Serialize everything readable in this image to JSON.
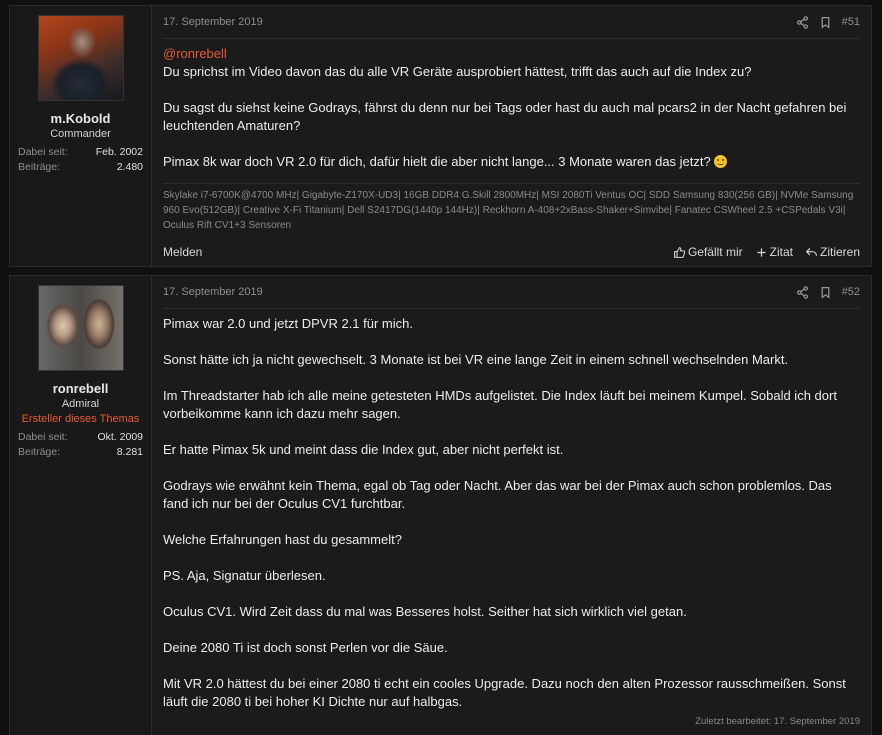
{
  "posts": [
    {
      "user": {
        "name": "m.Kobold",
        "title": "Commander",
        "joined_label": "Dabei seit:",
        "joined": "Feb. 2002",
        "posts_label": "Beiträge:",
        "posts": "2.480"
      },
      "date": "17. September 2019",
      "number": "#51",
      "mention": "@ronrebell",
      "lines": [
        "Du sprichst im Video davon das du alle VR Geräte ausprobiert hättest, trifft das auch auf die Index zu?",
        "Du sagst du siehst keine Godrays, fährst du denn nur bei Tags oder hast du auch mal pcars2 in der Nacht gefahren bei leuchtenden Amaturen?",
        "Pimax 8k war doch VR 2.0 für dich, dafür hielt die aber nicht lange... 3 Monate waren das jetzt?"
      ],
      "signature": "Skylake i7-6700K@4700 MHz| Gigabyte-Z170X-UD3| 16GB DDR4 G.Skill 2800MHz| MSI 2080Ti Ventus OC| SDD Samsung 830(256 GB)| NVMe Samsung 960 Evo(512GB)| Creative X-Fi Titanium| Dell S2417DG(1440p 144Hz)| Reckhorn A-408+2xBass-Shaker+Simvibe| Fanatec CSWheel 2.5 +CSPedals V3i| Oculus Rift CV1+3 Sensoren",
      "report": "Melden",
      "like": "Gefällt mir",
      "quote": "Zitat",
      "reply": "Zitieren"
    },
    {
      "user": {
        "name": "ronrebell",
        "title": "Admiral",
        "banner": "Ersteller dieses Themas",
        "joined_label": "Dabei seit:",
        "joined": "Okt. 2009",
        "posts_label": "Beiträge:",
        "posts": "8.281"
      },
      "date": "17. September 2019",
      "number": "#52",
      "lines": [
        "Pimax war 2.0 und jetzt DPVR 2.1 für mich.",
        "Sonst hätte ich ja nicht gewechselt. 3 Monate ist bei VR eine lange Zeit in einem schnell wechselnden Markt.",
        "Im Threadstarter hab ich alle meine getesteten HMDs aufgelistet. Die Index läuft bei meinem Kumpel. Sobald ich dort vorbeikomme kann ich dazu mehr sagen.",
        "Er hatte Pimax 5k und meint dass die Index gut, aber nicht perfekt ist.",
        "Godrays wie erwähnt kein Thema, egal ob Tag oder Nacht. Aber das war bei der Pimax auch schon problemlos. Das fand ich nur bei der Oculus CV1 furchtbar.",
        "Welche Erfahrungen hast du gesammelt?",
        "PS. Aja, Signatur überlesen.",
        "Oculus CV1. Wird Zeit dass du mal was Besseres holst. Seither hat sich wirklich viel getan.",
        "Deine 2080 Ti ist doch sonst Perlen vor die Säue.",
        "Mit VR 2.0 hättest du bei einer 2080 ti echt ein cooles Upgrade. Dazu noch den alten Prozessor rausschmeißen. Sonst läuft die 2080 ti bei hoher KI Dichte nur auf halbgas."
      ],
      "edited": "Zuletzt bearbeitet: 17. September 2019"
    }
  ],
  "icons": {
    "share": "share-icon",
    "bookmark": "bookmark-icon",
    "like": "thumbs-up-icon",
    "quote": "plus-icon",
    "reply": "reply-icon"
  },
  "colors": {
    "accent": "#e8573a",
    "background": "#101010",
    "panel": "#1b1b1b"
  }
}
